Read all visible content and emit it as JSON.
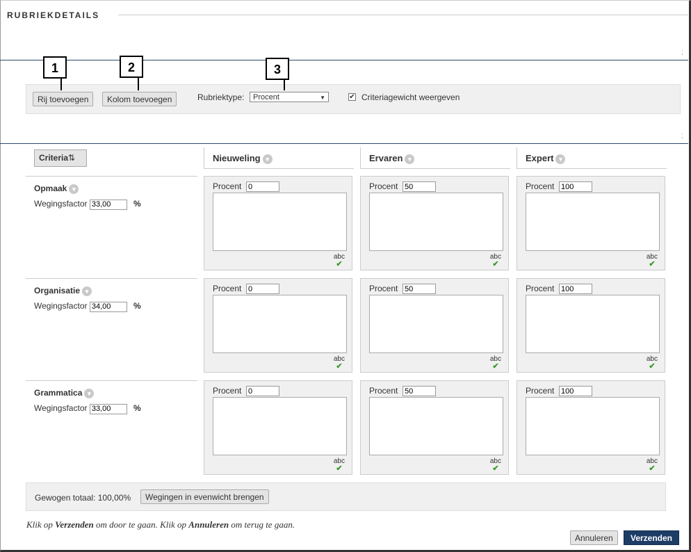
{
  "section_title": "RUBRIEKDETAILS",
  "toolbar": {
    "add_row_label": "Rij toevoegen",
    "add_column_label": "Kolom toevoegen",
    "rubric_type_label": "Rubriektype:",
    "rubric_type_value": "Procent",
    "show_weight_label": "Criteriagewicht weergeven",
    "show_weight_checked": true
  },
  "callouts": [
    "1",
    "2",
    "3"
  ],
  "grid": {
    "criteria_label": "Criteria",
    "columns": [
      "Nieuweling",
      "Ervaren",
      "Expert"
    ],
    "cell_label": "Procent",
    "spellcheck_label": "abc",
    "weight_label": "Wegingsfactor",
    "percent_sign": "%",
    "rows": [
      {
        "name": "Opmaak",
        "weight": "33,00",
        "values": [
          "0",
          "50",
          "100"
        ]
      },
      {
        "name": "Organisatie",
        "weight": "34,00",
        "values": [
          "0",
          "50",
          "100"
        ]
      },
      {
        "name": "Grammatica",
        "weight": "33,00",
        "values": [
          "0",
          "50",
          "100"
        ]
      }
    ]
  },
  "footer": {
    "total_label": "Gewogen totaal:",
    "total_value": "100,00%",
    "balance_button": "Wegingen in evenwicht brengen",
    "hint_prefix": "Klik op ",
    "hint_submit": "Verzenden",
    "hint_middle": " om door te gaan. Klik op ",
    "hint_cancel": "Annuleren",
    "hint_suffix": " om terug te gaan.",
    "cancel_label": "Annuleren",
    "submit_label": "Verzenden"
  }
}
